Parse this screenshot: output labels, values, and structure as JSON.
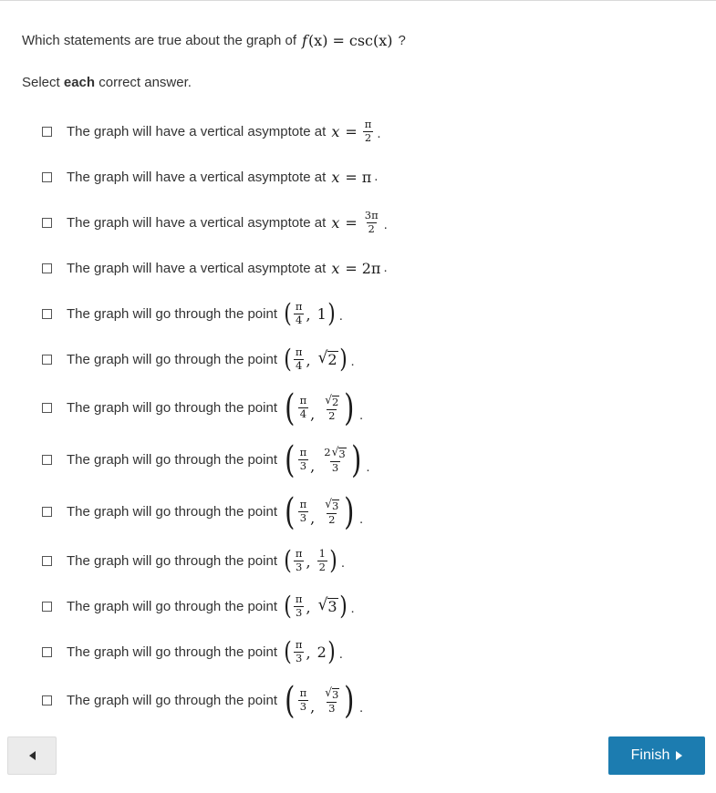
{
  "question": {
    "prefix": "Which statements are true about the graph of",
    "function_name": "f",
    "function_arg": "(x)",
    "equals": "=",
    "function_body": "csc",
    "function_body_arg": "(x)",
    "suffix": "?"
  },
  "instruction": {
    "before": "Select ",
    "emphasis": "each",
    "after": " correct answer."
  },
  "options": [
    {
      "lead": "The graph will have a vertical asymptote at",
      "var": "x",
      "op": "=",
      "value_type": "fraction",
      "num": "π",
      "den": "2",
      "period": "."
    },
    {
      "lead": "The graph will have a vertical asymptote at",
      "var": "x",
      "op": "=",
      "value_type": "plain",
      "value": "π",
      "period": "."
    },
    {
      "lead": "The graph will have a vertical asymptote at",
      "var": "x",
      "op": "=",
      "value_type": "fraction",
      "num": "3π",
      "den": "2",
      "period": "."
    },
    {
      "lead": "The graph will have a vertical asymptote at",
      "var": "x",
      "op": "=",
      "value_type": "plain",
      "value": "2π",
      "period": "."
    },
    {
      "lead": "The graph will go through the point",
      "x_num": "π",
      "x_den": "4",
      "y_type": "plain",
      "y_value": "1",
      "period": "."
    },
    {
      "lead": "The graph will go through the point",
      "x_num": "π",
      "x_den": "4",
      "y_type": "sqrt",
      "y_radicand": "2",
      "period": "."
    },
    {
      "lead": "The graph will go through the point",
      "x_num": "π",
      "x_den": "4",
      "y_type": "fraction_sqrt",
      "y_num_radicand": "2",
      "y_den": "2",
      "period": "."
    },
    {
      "lead": "The graph will go through the point",
      "x_num": "π",
      "x_den": "3",
      "y_type": "fraction_coef_sqrt",
      "y_coef": "2",
      "y_num_radicand": "3",
      "y_den": "3",
      "period": "."
    },
    {
      "lead": "The graph will go through the point",
      "x_num": "π",
      "x_den": "3",
      "y_type": "fraction_sqrt",
      "y_num_radicand": "3",
      "y_den": "2",
      "period": "."
    },
    {
      "lead": "The graph will go through the point",
      "x_num": "π",
      "x_den": "3",
      "y_type": "fraction",
      "y_num": "1",
      "y_den": "2",
      "period": "."
    },
    {
      "lead": "The graph will go through the point",
      "x_num": "π",
      "x_den": "3",
      "y_type": "sqrt",
      "y_radicand": "3",
      "period": "."
    },
    {
      "lead": "The graph will go through the point",
      "x_num": "π",
      "x_den": "3",
      "y_type": "plain",
      "y_value": "2",
      "period": "."
    },
    {
      "lead": "The graph will go through the point",
      "x_num": "π",
      "x_den": "3",
      "y_type": "fraction_sqrt",
      "y_num_radicand": "3",
      "y_den": "3",
      "period": "."
    }
  ],
  "footer": {
    "back_label": "",
    "back_icon": "triangle-left-icon",
    "finish_label": "Finish",
    "finish_icon": "triangle-right-icon"
  },
  "colors": {
    "accent": "#1c7cb0",
    "text": "#333333",
    "back_button_bg": "#ebebeb",
    "border": "#d9d9d9"
  }
}
